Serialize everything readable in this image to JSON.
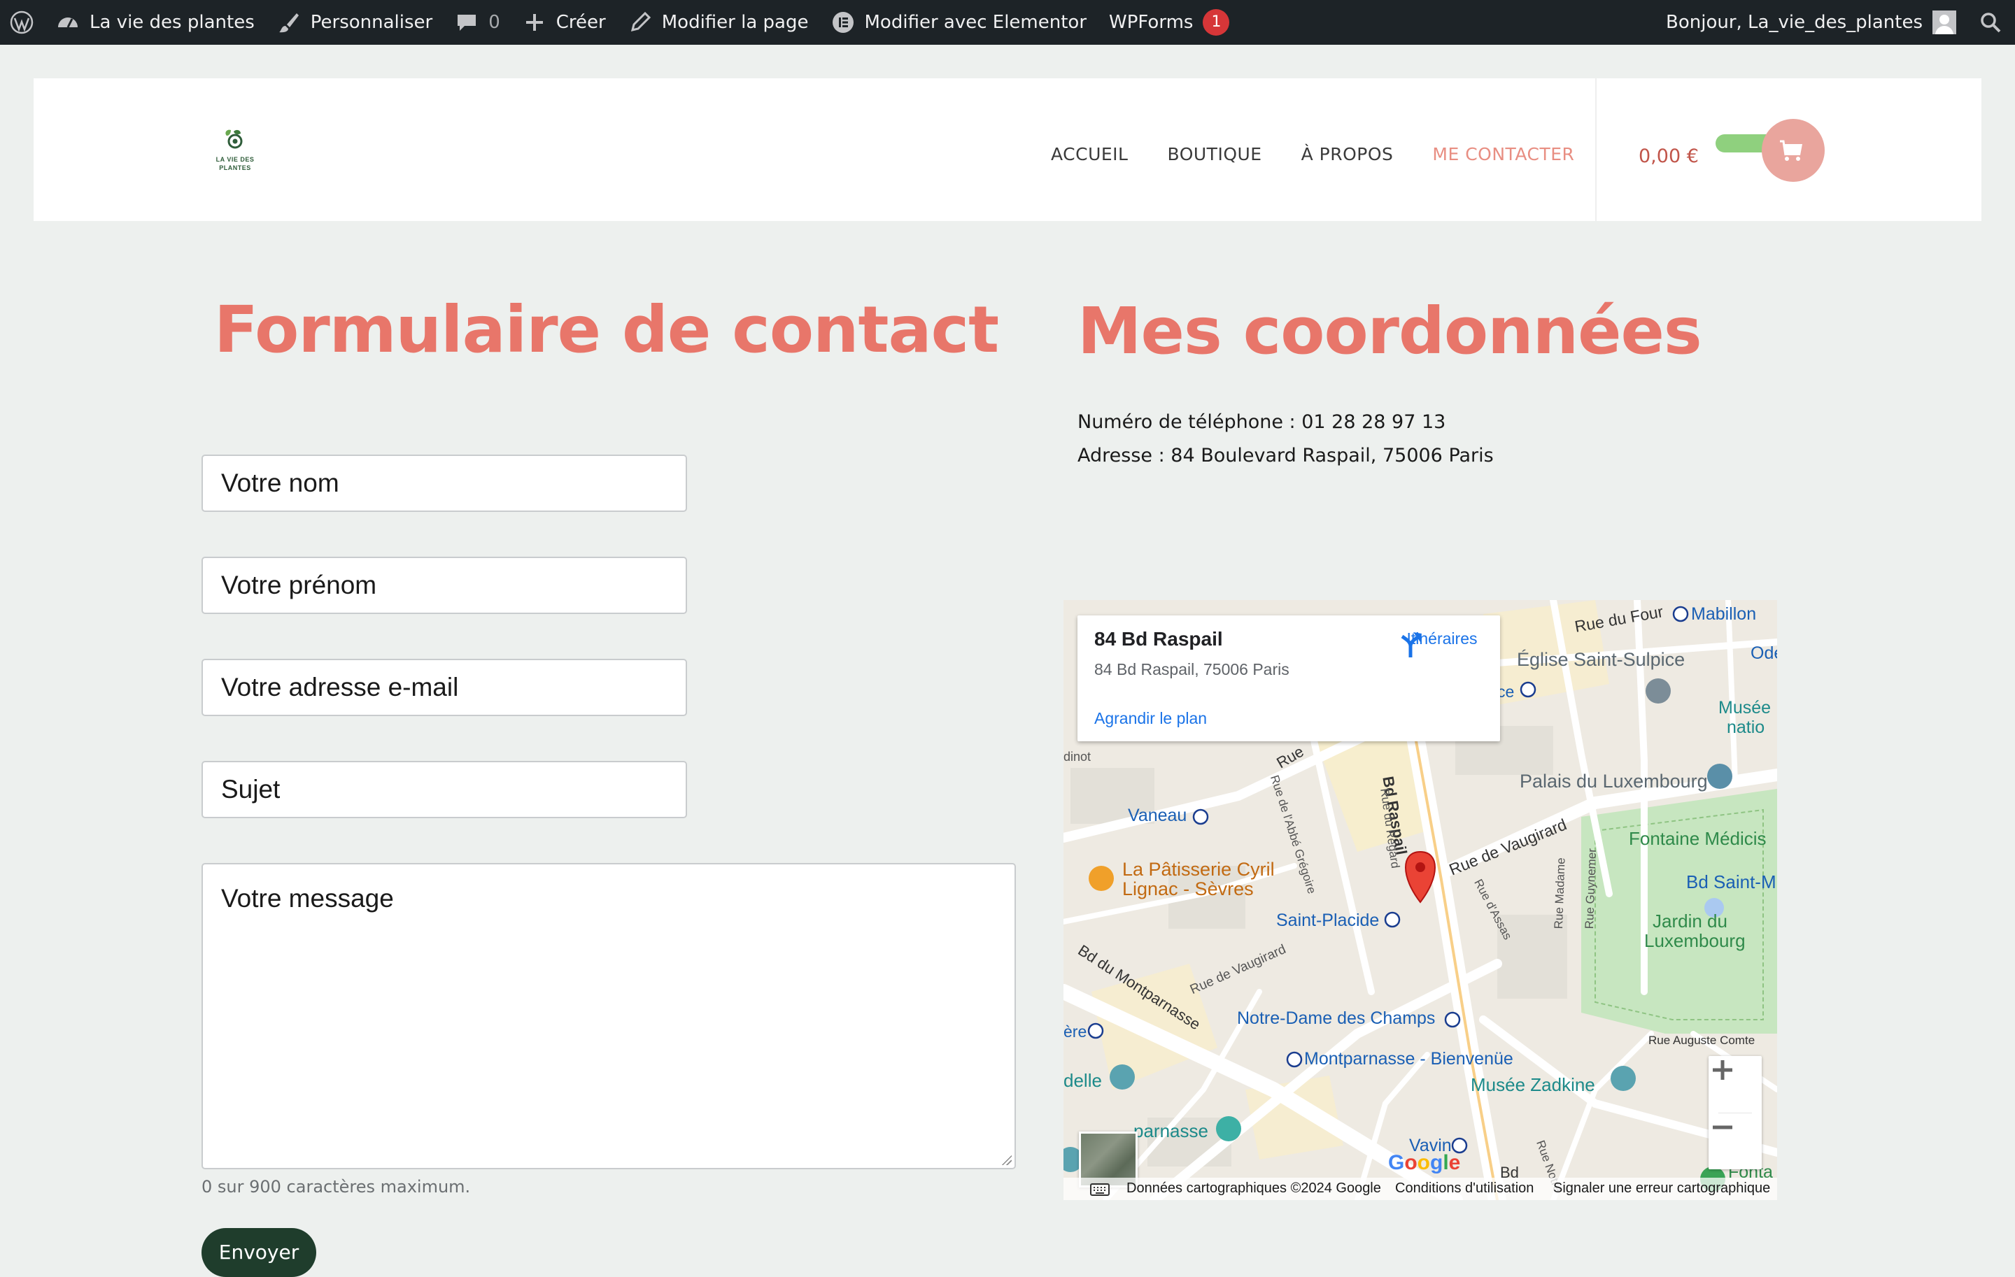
{
  "adminbar": {
    "site_name": "La vie des plantes",
    "customize": "Personnaliser",
    "comments_count": "0",
    "new": "Créer",
    "edit_page": "Modifier la page",
    "elementor": "Modifier avec Elementor",
    "wpforms": "WPForms",
    "wpforms_badge": "1",
    "greeting": "Bonjour, La_vie_des_plantes"
  },
  "header": {
    "logo_text": [
      "LA VIE DES",
      "PLANTES"
    ],
    "nav": [
      "ACCUEIL",
      "BOUTIQUE",
      "À PROPOS",
      "ME CONTACTER"
    ],
    "active_nav": "ME CONTACTER",
    "cart_total": "0,00 €"
  },
  "contact": {
    "title": "Formulaire de contact",
    "fields": {
      "name": "Votre nom",
      "firstname": "Votre prénom",
      "email": "Votre adresse e-mail",
      "subject": "Sujet",
      "message": "Votre message"
    },
    "char_count": "0 sur 900 caractères maximum.",
    "submit": "Envoyer"
  },
  "coords": {
    "title": "Mes coordonnées",
    "phone": "Numéro de téléphone : 01 28 28 97 13",
    "address": "Adresse : 84 Boulevard Raspail, 75006 Paris"
  },
  "map": {
    "card_title": "84 Bd Raspail",
    "card_address": "84 Bd Raspail, 75006 Paris",
    "directions": "Itinéraires",
    "enlarge": "Agrandir le plan",
    "labels": {
      "mabillon": "Mabillon",
      "rue_du_four": "Rue du Four",
      "odeon": "Odé",
      "eglise": "Église Saint-Sulpice",
      "musee_nat_1": "Musée",
      "musee_nat_2": "natio",
      "ce": "ce",
      "palais": "Palais du Luxembourg",
      "vaneau": "Vaneau",
      "fontaine": "Fontaine Médicis",
      "bd_saint_m": "Bd Saint-M",
      "patisserie_1": "La Pâtisserie Cyril",
      "patisserie_2": "Lignac - Sèvres",
      "rue_vaugirard": "Rue de Vaugirard",
      "rue_vaugirard_2": "Rue de Vaugirard",
      "jardin_1": "Jardin du",
      "jardin_2": "Luxembourg",
      "saint_placide": "Saint-Placide",
      "bd_raspail": "Bd Raspail",
      "bd_montparnasse": "Bd du Montparnasse",
      "rue_du_regard": "Rue du Regard",
      "rue_abbe": "Rue de l'Abbé Grégoire",
      "rue_assas": "Rue d'Assas",
      "rue_madame": "Rue Madame",
      "rue_guynemer": "Rue Guynemer",
      "rue_u": "Rue",
      "notre_dame": "Notre-Dame des Champs",
      "montparnasse": "Montparnasse - Bienvenüe",
      "musee_zadkine": "Musée Zadkine",
      "rue_auguste": "Rue Auguste Comte",
      "vavin": "Vavin",
      "rue_notre": "Rue Notre",
      "bd_short": "Bd",
      "parnasse": "parnasse",
      "delle": "delle",
      "ere": "ère",
      "font": "Fonta",
      "dinot": "dinot"
    },
    "footer": {
      "data": "Données cartographiques ©2024 Google",
      "terms": "Conditions d'utilisation",
      "report": "Signaler une erreur cartographique"
    },
    "google": "Google"
  }
}
